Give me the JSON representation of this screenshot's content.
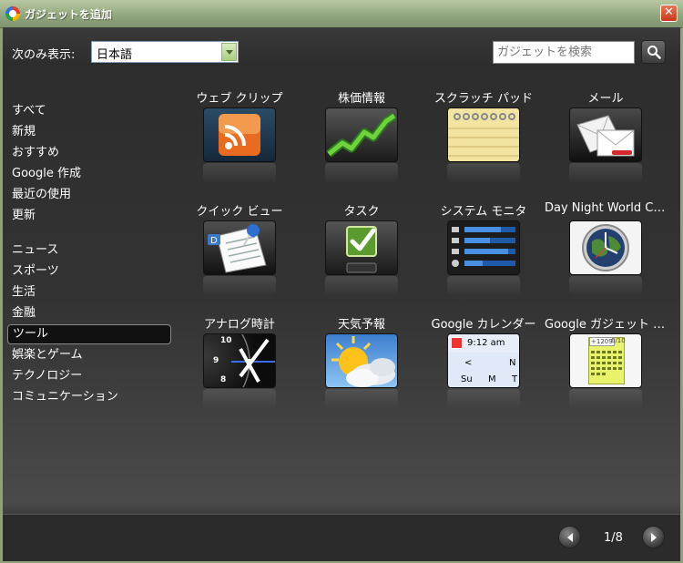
{
  "window": {
    "title": "ガジェットを追加",
    "close_label": "✕"
  },
  "filter": {
    "label": "次のみ表示:",
    "language": "日本語"
  },
  "search": {
    "placeholder": "ガジェットを検索"
  },
  "categories": {
    "group1": [
      "すべて",
      "新規",
      "おすすめ",
      "Google 作成",
      "最近の使用",
      "更新"
    ],
    "group2": [
      "ニュース",
      "スポーツ",
      "生活",
      "金融",
      "ツール",
      "娯楽とゲーム",
      "テクノロジー",
      "コミュニケーション"
    ],
    "selected": "ツール"
  },
  "gadgets": [
    {
      "name": "ウェブ クリップ",
      "icon": "rss-icon"
    },
    {
      "name": "株価情報",
      "icon": "stock-chart-icon"
    },
    {
      "name": "スクラッチ パッド",
      "icon": "notepad-icon"
    },
    {
      "name": "メール",
      "icon": "mail-icon"
    },
    {
      "name": "クイック ビュー",
      "icon": "document-pin-icon"
    },
    {
      "name": "タスク",
      "icon": "checkbox-icon"
    },
    {
      "name": "システム モニタ",
      "icon": "system-monitor-icon"
    },
    {
      "name": "Day Night World Clock",
      "icon": "world-clock-icon"
    },
    {
      "name": "アナログ時計",
      "icon": "analog-clock-icon",
      "clock_numbers": [
        "10",
        "9",
        "8"
      ]
    },
    {
      "name": "天気予報",
      "icon": "weather-icon"
    },
    {
      "name": "Google カレンダー",
      "icon": "calendar-icon",
      "time": "9:12 am",
      "nav": "<",
      "nav_next": "N",
      "days": [
        "Su",
        "M",
        "T"
      ]
    },
    {
      "name": "Google ガジェット カレンダー",
      "icon": "calendar-grid-icon",
      "badge_top": "+1209",
      "badge_date": "6/10"
    }
  ],
  "pagination": {
    "text": "1/8",
    "prev_icon": "chevron-left-icon",
    "next_icon": "chevron-right-icon"
  },
  "colors": {
    "titlebar": "#8fa57c",
    "close": "#c8391b",
    "background": "#333333",
    "text": "#ffffff"
  }
}
